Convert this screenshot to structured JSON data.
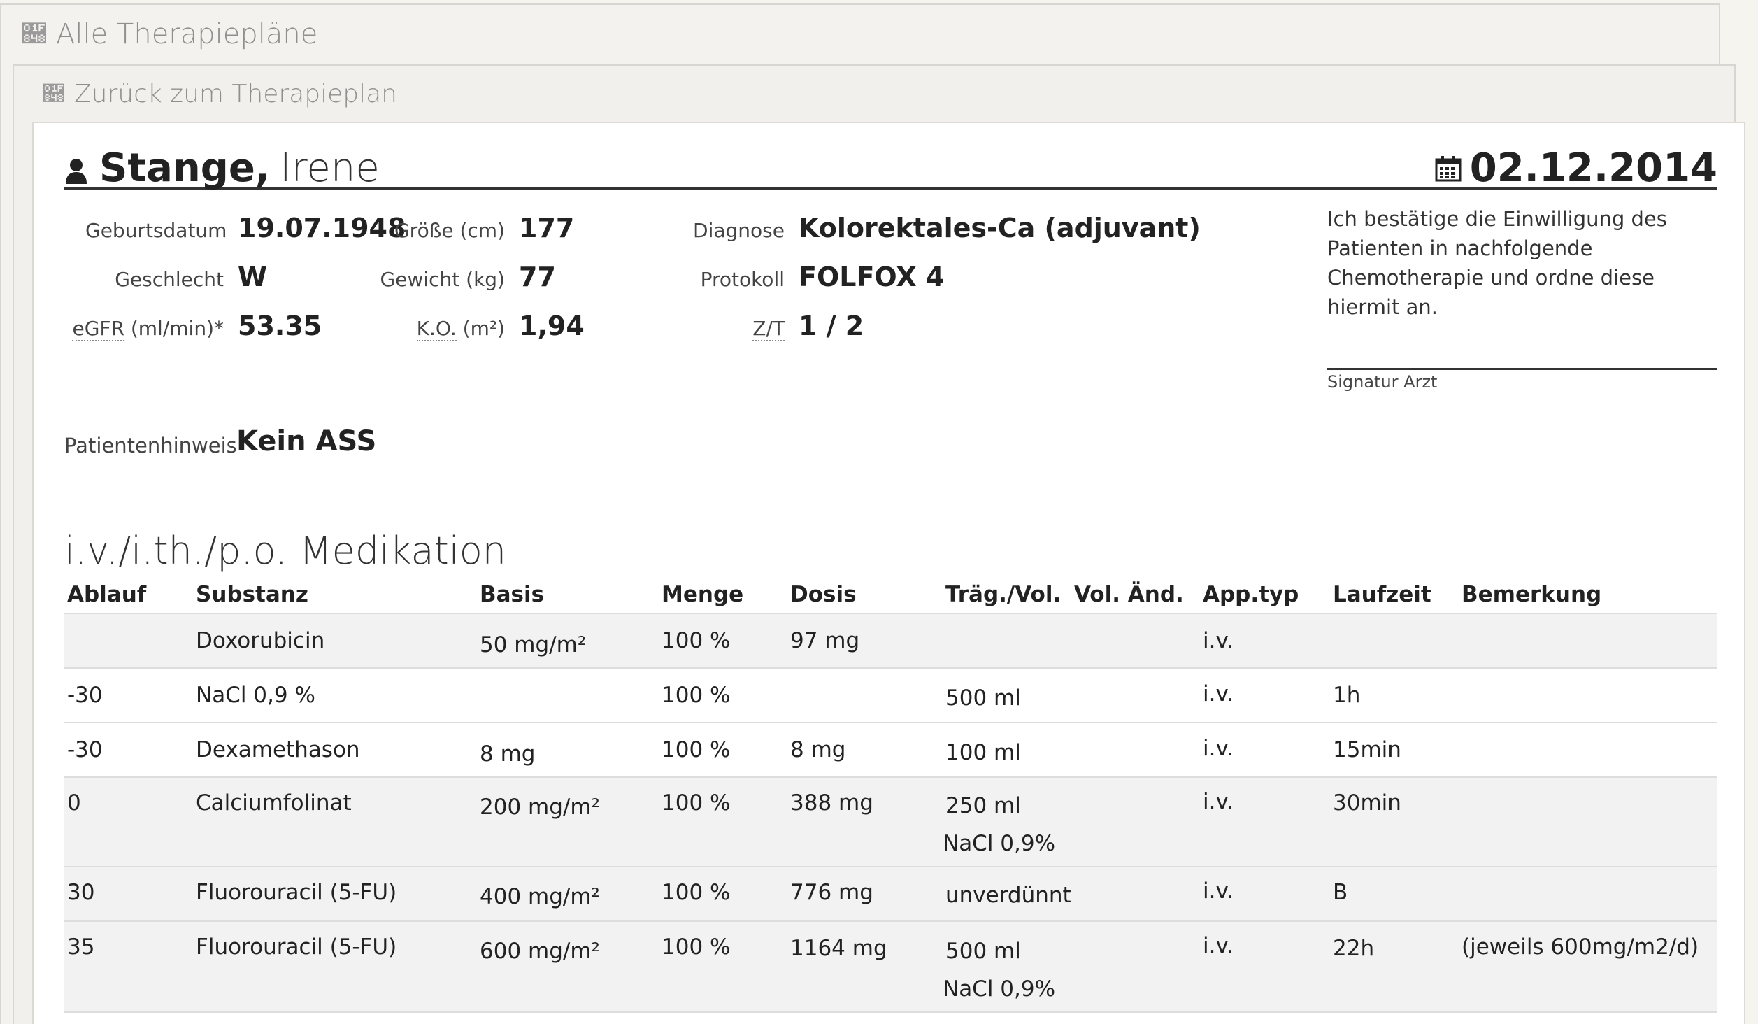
{
  "nav": {
    "back_all": "Alle Therapiepläne",
    "back_plan": "Zurück zum Therapieplan"
  },
  "patient": {
    "last_name": "Stange,",
    "first_name": "Irene",
    "date": "02.12.2014",
    "icons": {
      "person": "user-icon",
      "calendar": "calendar-icon"
    }
  },
  "fields": {
    "birth_label": "Geburtsdatum",
    "birth_value": "19.07.1948",
    "sex_label": "Geschlecht",
    "sex_value": "W",
    "egfr_label_abbr": "eGFR",
    "egfr_label_unit": " (ml/min)*",
    "egfr_value": "53.35",
    "height_label": "Größe (cm)",
    "height_value": "177",
    "weight_label": "Gewicht (kg)",
    "weight_value": "77",
    "ko_label_abbr": "K.O.",
    "ko_label_unit": " (m²)",
    "ko_value": "1,94",
    "diag_label": "Diagnose",
    "diag_value": "Kolorektales-Ca (adjuvant)",
    "prot_label": "Protokoll",
    "prot_value": "FOLFOX 4",
    "zt_label": "Z/T",
    "zt_value": "1 / 2"
  },
  "consent": {
    "text": "Ich bestätige die Einwilligung des Patienten in nachfolgende Chemotherapie und ordne diese hiermit an.",
    "signature_label": "Signatur Arzt"
  },
  "hint": {
    "label": "Patientenhinweis",
    "value": "Kein ASS"
  },
  "medication": {
    "title": "i.v./i.th./p.o. Medikation",
    "headers": {
      "ablauf": "Ablauf",
      "substanz": "Substanz",
      "basis": "Basis",
      "menge": "Menge",
      "dosis": "Dosis",
      "trag": "Träg./Vol.",
      "vol": "Vol. Änd.",
      "app": "App.typ",
      "lauf": "Laufzeit",
      "bem": "Bemerkung"
    },
    "rows": [
      {
        "ablauf": "",
        "substanz": "Doxorubicin",
        "basis": "50 mg/m²",
        "menge": "100 %",
        "dosis": "97 mg",
        "trag": "",
        "trag2": "",
        "vol": "",
        "app": "i.v.",
        "lauf": "",
        "bem": ""
      },
      {
        "ablauf": "-30",
        "substanz": "NaCl 0,9 %",
        "basis": "",
        "menge": "100 %",
        "dosis": "",
        "trag": "500 ml",
        "trag2": "",
        "vol": "",
        "app": "i.v.",
        "lauf": "1h",
        "bem": ""
      },
      {
        "ablauf": "-30",
        "substanz": "Dexamethason",
        "basis": "8 mg",
        "menge": "100 %",
        "dosis": "8 mg",
        "trag": "100 ml",
        "trag2": "",
        "vol": "",
        "app": "i.v.",
        "lauf": "15min",
        "bem": ""
      },
      {
        "ablauf": "0",
        "substanz": "Calciumfolinat",
        "basis": "200 mg/m²",
        "menge": "100 %",
        "dosis": "388 mg",
        "trag": "250 ml",
        "trag2": "NaCl 0,9%",
        "vol": "",
        "app": "i.v.",
        "lauf": "30min",
        "bem": ""
      },
      {
        "ablauf": "30",
        "substanz": "Fluorouracil (5-FU)",
        "basis": "400 mg/m²",
        "menge": "100 %",
        "dosis": "776 mg",
        "trag": "unverdünnt",
        "trag2": "",
        "vol": "",
        "app": "i.v.",
        "lauf": "B",
        "bem": ""
      },
      {
        "ablauf": "35",
        "substanz": "Fluorouracil (5-FU)",
        "basis": "600 mg/m²",
        "menge": "100 %",
        "dosis": "1164 mg",
        "trag": "500 ml",
        "trag2": "NaCl 0,9%",
        "vol": "",
        "app": "i.v.",
        "lauf": "22h",
        "bem": "(jeweils 600mg/m2/d)"
      }
    ]
  }
}
